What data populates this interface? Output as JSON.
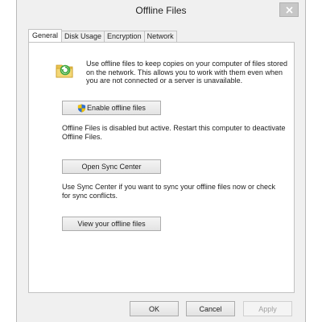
{
  "window": {
    "title": "Offline Files"
  },
  "tabs": [
    {
      "label": "General",
      "active": true
    },
    {
      "label": "Disk Usage",
      "active": false
    },
    {
      "label": "Encryption",
      "active": false
    },
    {
      "label": "Network",
      "active": false
    }
  ],
  "general": {
    "intro_lines": [
      "Use offline files to keep copies on your computer of files stored",
      "on the network.  This allows you to work with them even when",
      "you are not connected or a server is unavailable."
    ],
    "enable_button": "Enable offline files",
    "status_lines": [
      "Offline Files is disabled but active.  Restart this computer to deactivate",
      "Offline Files."
    ],
    "sync_button": "Open Sync Center",
    "sync_lines": [
      "Use Sync Center if you want to sync your offline files now or check",
      "for sync conflicts."
    ],
    "view_button": "View your offline files"
  },
  "footer": {
    "ok": "OK",
    "cancel": "Cancel",
    "apply": "Apply"
  },
  "icons": {
    "folder": "offline-folder-icon",
    "shield": "uac-shield-icon",
    "close": "close-icon"
  },
  "colors": {
    "folder": "#e9c24f",
    "sync_arrow": "#3aa53a",
    "shield_blue": "#2f6fd0",
    "shield_yellow": "#f2c200"
  }
}
